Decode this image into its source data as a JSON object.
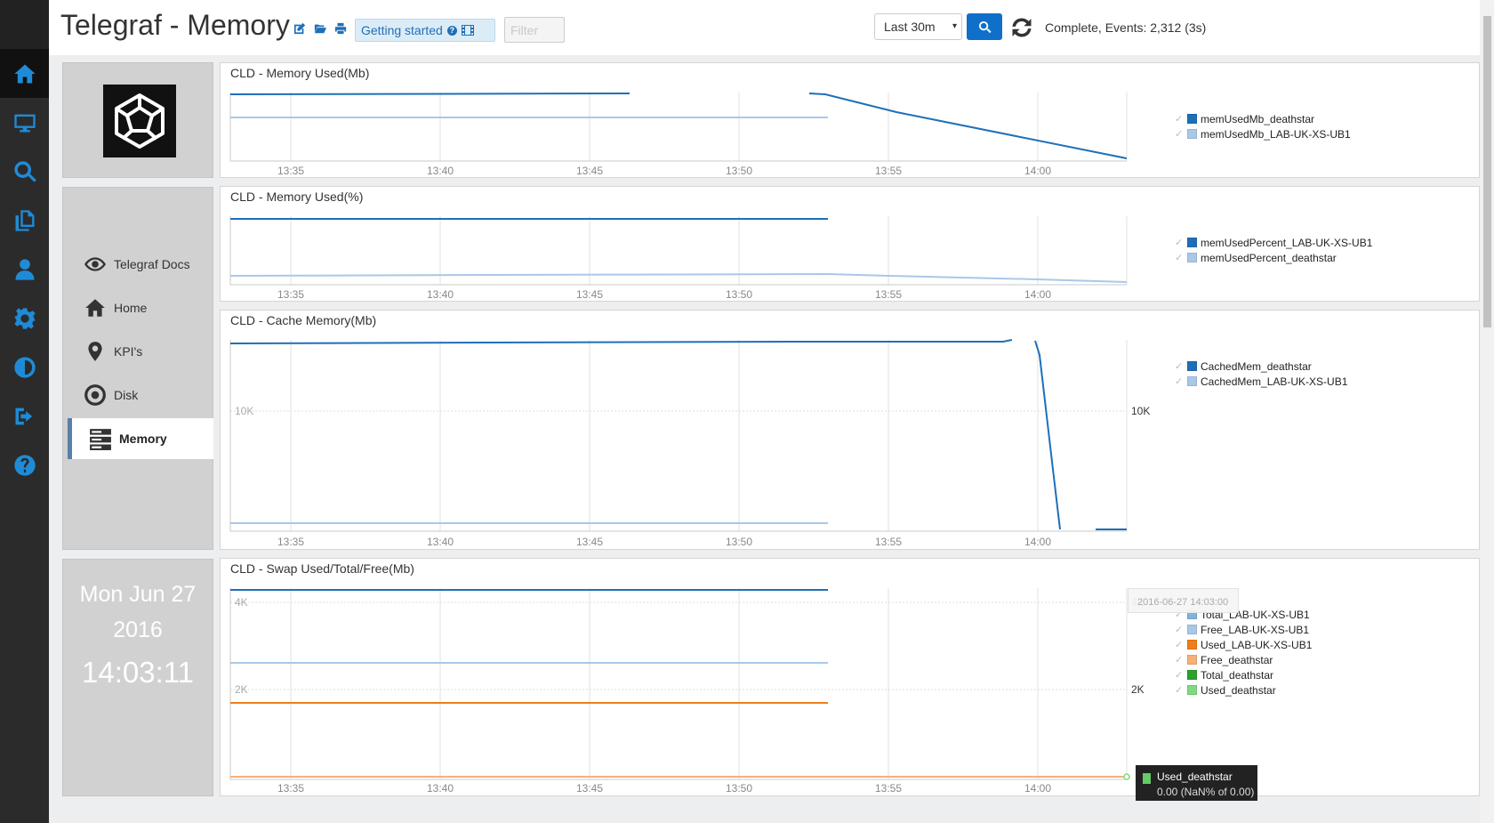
{
  "app": {
    "title": "Telegraf - Memory",
    "getting_started_label": "Getting started",
    "filter_placeholder": "Filter",
    "time_range": "Last 30m",
    "status": "Complete, Events: 2,312 (3s)"
  },
  "left_nav": {
    "icons": [
      "home-icon",
      "monitor-icon",
      "search-icon",
      "copy-icon",
      "user-icon",
      "gear-icon",
      "contrast-icon",
      "logout-icon",
      "help-icon"
    ],
    "active_index": 0,
    "accent_color": "#1f8bd6"
  },
  "side_menu": {
    "items": [
      {
        "label": "Telegraf Docs",
        "icon": "eye-icon"
      },
      {
        "label": "Home",
        "icon": "home-icon"
      },
      {
        "label": "KPI's",
        "icon": "map-marker-icon"
      },
      {
        "label": "Disk",
        "icon": "disk-icon"
      },
      {
        "label": "Memory",
        "icon": "server-icon",
        "active": true
      }
    ]
  },
  "clock": {
    "day": "Mon Jun 27",
    "year": "2016",
    "time": "14:03:11"
  },
  "chart_data": [
    {
      "type": "line",
      "title": "CLD - Memory Used(Mb)",
      "x_ticks": [
        "13:35",
        "13:40",
        "13:45",
        "13:50",
        "13:55",
        "14:00"
      ],
      "grid": true,
      "legend": "right",
      "series": [
        {
          "name": "memUsedMb_deathstar",
          "color": "#1f6fb8"
        },
        {
          "name": "memUsedMb_LAB-UK-XS-UB1",
          "color": "#a9c8e8"
        }
      ]
    },
    {
      "type": "line",
      "title": "CLD - Memory Used(%)",
      "x_ticks": [
        "13:35",
        "13:40",
        "13:45",
        "13:50",
        "13:55",
        "14:00"
      ],
      "grid": true,
      "legend": "right",
      "series": [
        {
          "name": "memUsedPercent_LAB-UK-XS-UB1",
          "color": "#1f6fb8"
        },
        {
          "name": "memUsedPercent_deathstar",
          "color": "#a9c8e8"
        }
      ]
    },
    {
      "type": "line",
      "title": "CLD - Cache Memory(Mb)",
      "x_ticks": [
        "13:35",
        "13:40",
        "13:45",
        "13:50",
        "13:55",
        "14:00"
      ],
      "y_ticks": [
        "10K"
      ],
      "grid": true,
      "legend": "right",
      "series": [
        {
          "name": "CachedMem_deathstar",
          "color": "#1f6fb8"
        },
        {
          "name": "CachedMem_LAB-UK-XS-UB1",
          "color": "#a9c8e8"
        }
      ]
    },
    {
      "type": "line",
      "title": "CLD - Swap Used/Total/Free(Mb)",
      "x_ticks": [
        "13:35",
        "13:40",
        "13:45",
        "13:50",
        "13:55",
        "14:00"
      ],
      "y_ticks": [
        "4K",
        "2K"
      ],
      "grid": true,
      "legend": "right",
      "series": [
        {
          "name": "Total_LAB-UK-XS-UB1",
          "color": "#7fb4e0"
        },
        {
          "name": "Free_LAB-UK-XS-UB1",
          "color": "#a9c8e8"
        },
        {
          "name": "Used_LAB-UK-XS-UB1",
          "color": "#f07d1a"
        },
        {
          "name": "Free_deathstar",
          "color": "#f7b07a"
        },
        {
          "name": "Total_deathstar",
          "color": "#2ca02c"
        },
        {
          "name": "Used_deathstar",
          "color": "#7fd97f"
        }
      ]
    }
  ],
  "tooltip": {
    "date": "2016-06-27 14:03:00",
    "series": "Used_deathstar",
    "value": "0.00 (NaN% of 0.00)"
  }
}
